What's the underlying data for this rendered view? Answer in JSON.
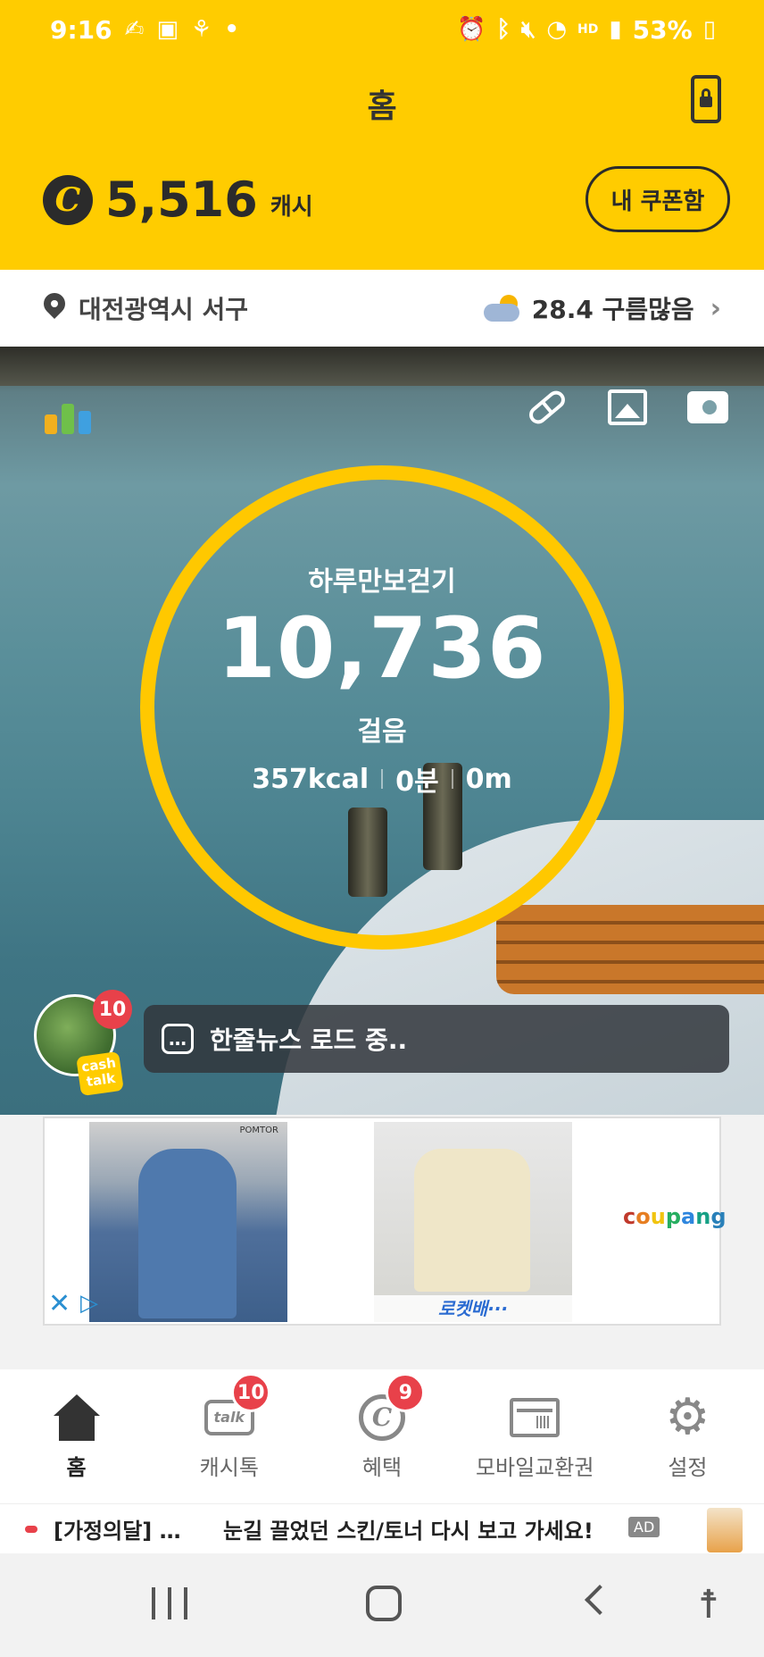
{
  "status_bar": {
    "time": "9:16",
    "battery": "53%",
    "left_icons": [
      "notification-icon",
      "gallery-icon",
      "app-icon",
      "dot-icon"
    ],
    "right_icons": [
      "alarm-icon",
      "bluetooth-icon",
      "mute-icon",
      "wifi-icon",
      "hd-voice-icon",
      "signal-icon",
      "battery-icon"
    ]
  },
  "header": {
    "title": "홈",
    "cash_amount": "5,516",
    "cash_unit": "캐시",
    "coin_symbol": "C",
    "coupon_button": "내 쿠폰함"
  },
  "location": {
    "place": "대전광역시 서구",
    "weather": "28.4 구름많음"
  },
  "pedometer": {
    "label": "하루만보걷기",
    "steps": "10,736",
    "unit": "걸음",
    "kcal": "357kcal",
    "minutes": "0분",
    "distance": "0m"
  },
  "cashtalk": {
    "badge": "10",
    "logo_line1": "cash",
    "logo_line2": "talk",
    "news_dots": "…",
    "news_text": "한줄뉴스 로드 중.."
  },
  "ad_banner": {
    "img1_brand": "POMTOR",
    "rocket_label": "로켓배···",
    "brand": "coupang",
    "close": "✕",
    "choice": "▷"
  },
  "tabbar": {
    "tabs": [
      {
        "label": "홈",
        "icon": "home-icon",
        "active": true
      },
      {
        "label": "캐시톡",
        "icon": "talk-icon",
        "badge": "10"
      },
      {
        "label": "혜택",
        "icon": "benefit-icon",
        "badge": "9"
      },
      {
        "label": "모바일교환권",
        "icon": "gift-card-icon"
      },
      {
        "label": "설정",
        "icon": "gear-icon"
      }
    ],
    "talk_icon_text": "talk",
    "benefit_icon_text": "C",
    "gear_glyph": "⚙"
  },
  "ad_strip": {
    "left_text": "[가정의달] 제...",
    "main_text": "눈길 끌었던 스킨/토너 다시 보고 가세요!",
    "ad_tag": "AD"
  },
  "system_nav": {
    "accessibility_glyph": "☨"
  },
  "colors": {
    "brand_yellow": "#ffcc00",
    "ring_yellow": "#ffc800",
    "badge_red": "#e8414a",
    "coupang_c": "#c0392b"
  }
}
